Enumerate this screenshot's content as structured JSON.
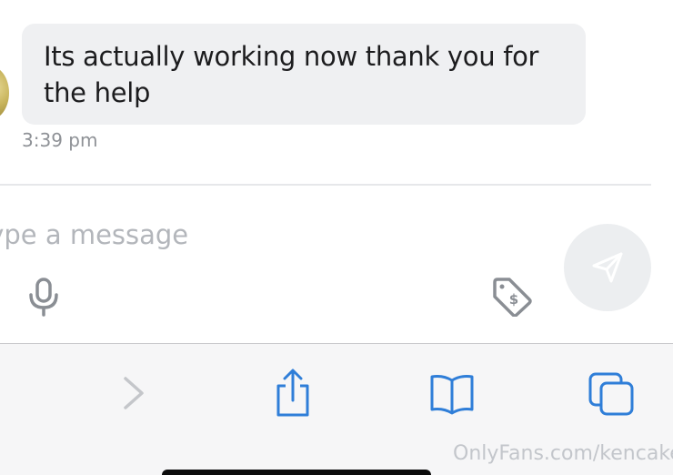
{
  "chat": {
    "message_text": "Its actually working now thank you for the help",
    "message_time": "3:39 pm"
  },
  "composer": {
    "placeholder": "Type a message",
    "icons": [
      "microphone-icon",
      "price-tag-icon",
      "send-icon"
    ]
  },
  "browser_toolbar": {
    "icons": [
      "forward-icon",
      "share-icon",
      "bookmarks-icon",
      "tabs-icon"
    ],
    "accent_color": "#2f7ed8",
    "disabled_color": "#c4c6ca"
  },
  "watermark": {
    "text": "OnlyFans.com/kencake"
  }
}
